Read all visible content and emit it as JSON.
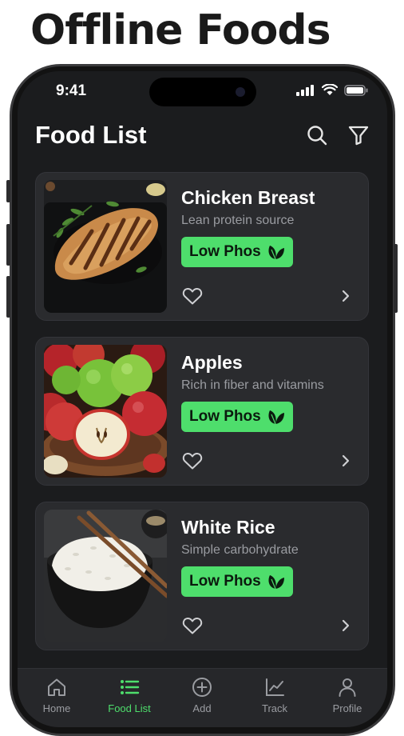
{
  "promo": {
    "headline": "Offline Foods"
  },
  "status_bar": {
    "time": "9:41"
  },
  "header": {
    "title": "Food List",
    "search_icon": "search-icon",
    "filter_icon": "filter-icon"
  },
  "foods": [
    {
      "name": "Chicken Breast",
      "description": "Lean protein source",
      "badge": "Low Phos",
      "image": "chicken-breast-photo"
    },
    {
      "name": "Apples",
      "description": "Rich in fiber and vitamins",
      "badge": "Low Phos",
      "image": "apples-photo"
    },
    {
      "name": "White Rice",
      "description": "Simple carbohydrate",
      "badge": "Low Phos",
      "image": "white-rice-photo"
    }
  ],
  "tabbar": {
    "items": [
      {
        "label": "Home",
        "icon": "home-icon"
      },
      {
        "label": "Food List",
        "icon": "list-icon",
        "active": true
      },
      {
        "label": "Add",
        "icon": "plus-circle-icon"
      },
      {
        "label": "Track",
        "icon": "chart-icon"
      },
      {
        "label": "Profile",
        "icon": "user-icon"
      }
    ]
  },
  "colors": {
    "accent": "#4ede6c",
    "background": "#1b1c1e",
    "card": "#2a2b2e"
  }
}
